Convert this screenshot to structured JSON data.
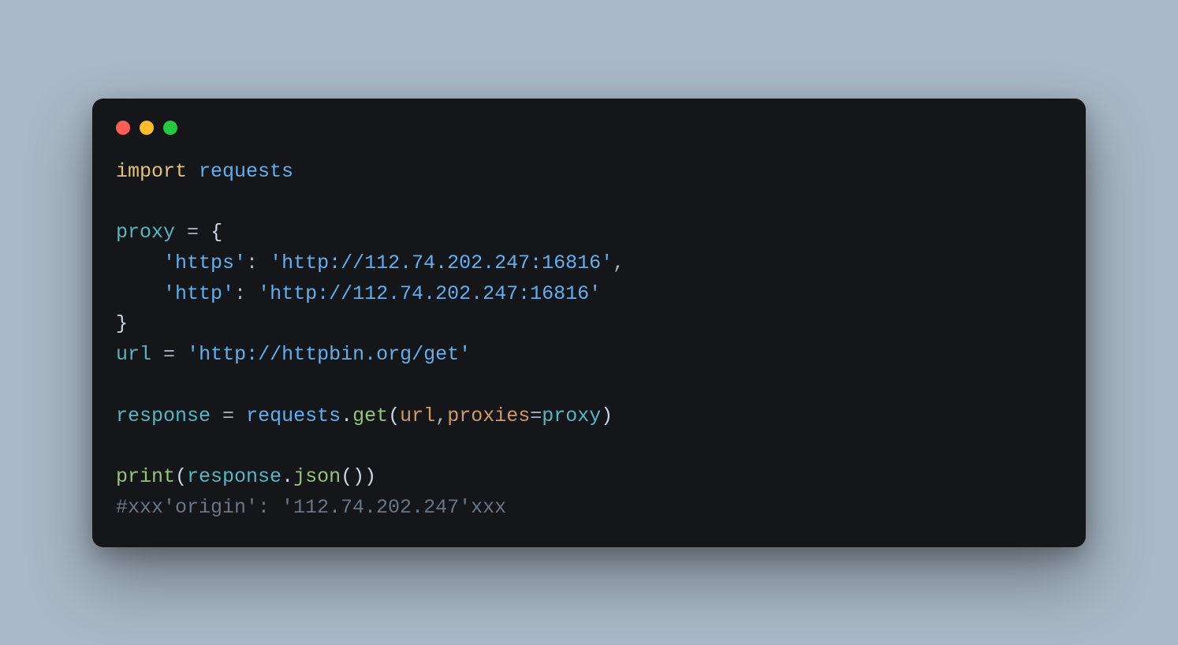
{
  "code": {
    "l1_import": "import",
    "l1_requests": "requests",
    "l3_proxy": "proxy",
    "l3_eq": "=",
    "l3_brace": "{",
    "l4_indent": "    ",
    "l4_key": "'https'",
    "l4_colon": ":",
    "l4_val": "'http://112.74.202.247:16816'",
    "l4_comma": ",",
    "l5_indent": "    ",
    "l5_key": "'http'",
    "l5_colon": ":",
    "l5_val": "'http://112.74.202.247:16816'",
    "l6_brace": "}",
    "l7_url": "url",
    "l7_eq": "=",
    "l7_val": "'http://httpbin.org/get'",
    "l9_resp": "response",
    "l9_eq": "=",
    "l9_requests": "requests",
    "l9_dot": ".",
    "l9_get": "get",
    "l9_lp": "(",
    "l9_arg_url": "url",
    "l9_comma": ",",
    "l9_proxies": "proxies",
    "l9_eq2": "=",
    "l9_proxy": "proxy",
    "l9_rp": ")",
    "l11_print": "print",
    "l11_lp": "(",
    "l11_resp": "response",
    "l11_dot": ".",
    "l11_json": "json",
    "l11_lp2": "(",
    "l11_rp2": ")",
    "l11_rp": ")",
    "l12_comment": "#xxx'origin': '112.74.202.247'xxx"
  }
}
